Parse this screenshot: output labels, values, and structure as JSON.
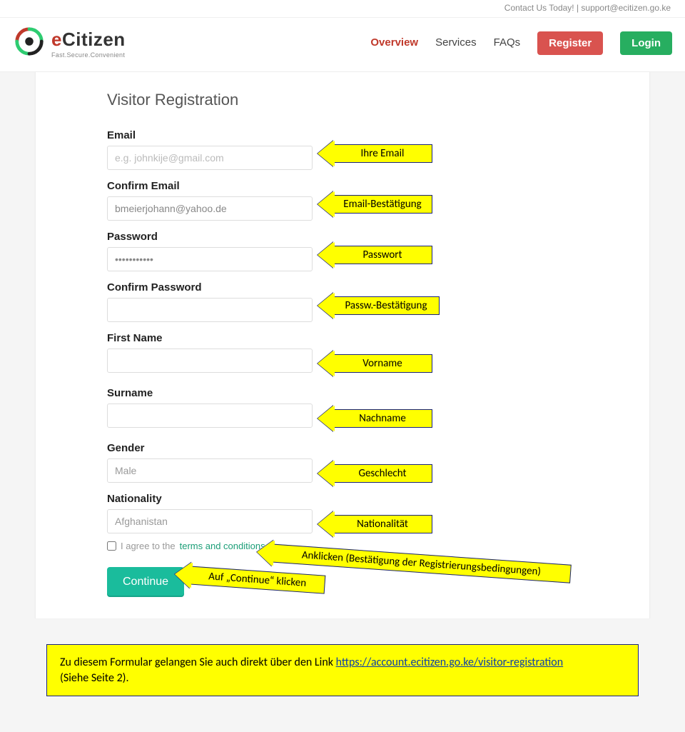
{
  "topbar": {
    "contact": "Contact Us Today! | support@ecitizen.go.ke"
  },
  "brand": {
    "e": "e",
    "rest": "Citizen",
    "sub": "Fast.Secure.Convenient"
  },
  "nav": {
    "overview": "Overview",
    "services": "Services",
    "faqs": "FAQs",
    "register": "Register",
    "login": "Login"
  },
  "page": {
    "title": "Visitor Registration"
  },
  "form": {
    "email_label": "Email",
    "email_placeholder": "e.g. johnkije@gmail.com",
    "confirm_email_label": "Confirm Email",
    "confirm_email_value": "bmeierjohann@yahoo.de",
    "password_label": "Password",
    "password_value": "•••••••••••",
    "confirm_password_label": "Confirm Password",
    "first_name_label": "First Name",
    "surname_label": "Surname",
    "gender_label": "Gender",
    "gender_value": "Male",
    "nationality_label": "Nationality",
    "nationality_value": "Afghanistan",
    "terms_prefix": "I agree to the ",
    "terms_link": "terms and conditions",
    "continue": "Continue"
  },
  "callouts": {
    "email": "Ihre Email",
    "confirm_email": "Email-Bestätigung",
    "password": "Passwort",
    "confirm_password": "Passw.-Bestätigung",
    "first_name": "Vorname",
    "surname": "Nachname",
    "gender": "Geschlecht",
    "nationality": "Nationalität",
    "terms": "Anklicken (Bestätigung der Registrierungsbedingungen)",
    "continue": "Auf „Continue“ klicken"
  },
  "note": {
    "text_before": "Zu diesem Formular gelangen Sie auch direkt über den Link ",
    "link_text": "https://account.ecitizen.go.ke/visitor-registration",
    "text_after": " (Siehe Seite 2)."
  }
}
